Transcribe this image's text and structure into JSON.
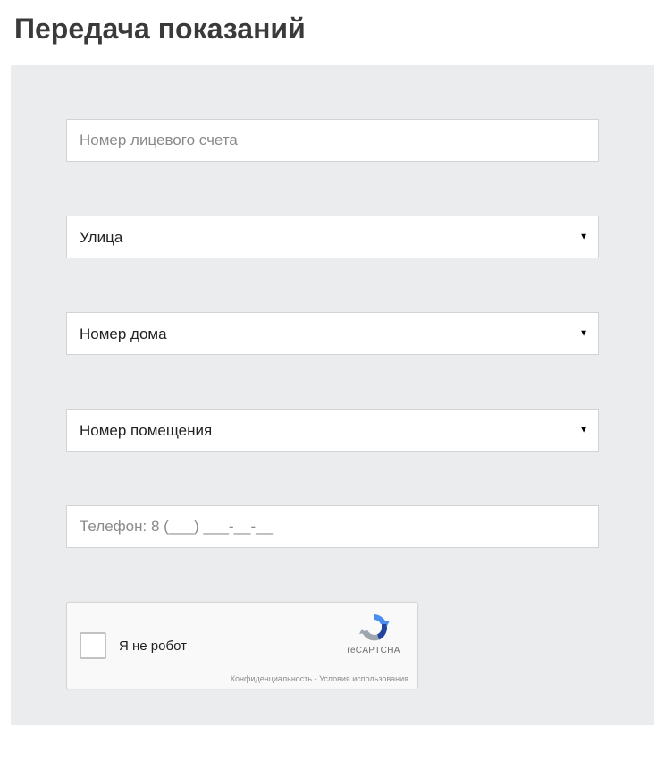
{
  "page": {
    "title": "Передача показаний"
  },
  "form": {
    "account_number": {
      "placeholder": "Номер лицевого счета",
      "value": ""
    },
    "street": {
      "selected": "Улица"
    },
    "house_number": {
      "selected": "Номер дома"
    },
    "room_number": {
      "selected": "Номер помещения"
    },
    "phone": {
      "placeholder": "Телефон: 8 (___) ___-__-__",
      "value": ""
    }
  },
  "recaptcha": {
    "label": "Я не робот",
    "brand": "reCAPTCHA",
    "footer": "Конфиденциальность - Условия использования"
  }
}
